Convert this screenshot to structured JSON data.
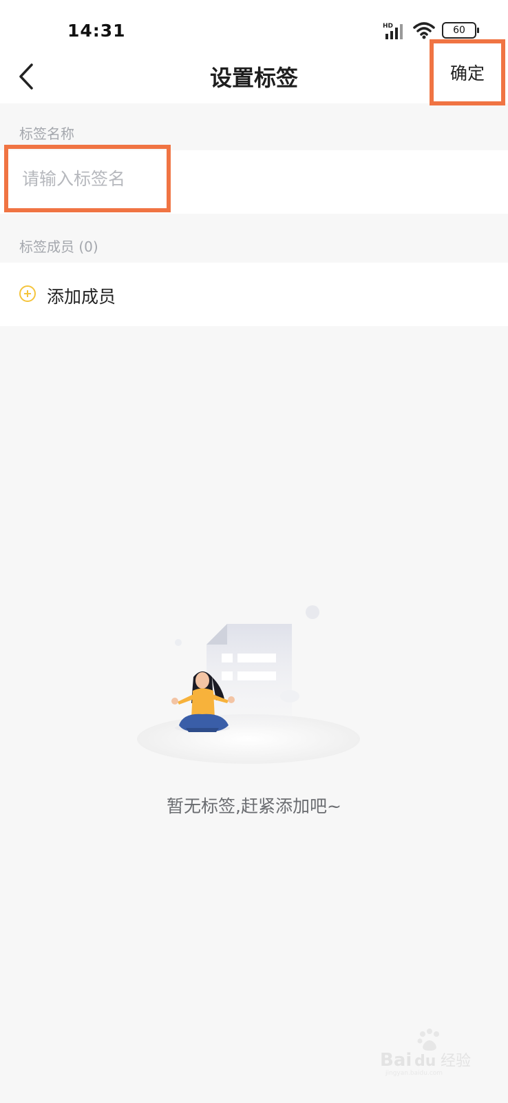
{
  "status_bar": {
    "time": "14:31",
    "battery": "60",
    "network_badge": "HD"
  },
  "nav": {
    "title": "设置标签",
    "confirm_label": "确定"
  },
  "tag_name_section": {
    "label": "标签名称",
    "input_placeholder": "请输入标签名",
    "input_value": ""
  },
  "members_section": {
    "label": "标签成员 (0)",
    "add_member_label": "添加成员"
  },
  "empty_state": {
    "message": "暂无标签,赶紧添加吧~"
  },
  "watermark": {
    "text": "Baidu经验",
    "subtext": "jingyan.baidu.com"
  },
  "colors": {
    "highlight": "#f07443",
    "accent": "#f5c43b",
    "background": "#f7f7f7"
  }
}
